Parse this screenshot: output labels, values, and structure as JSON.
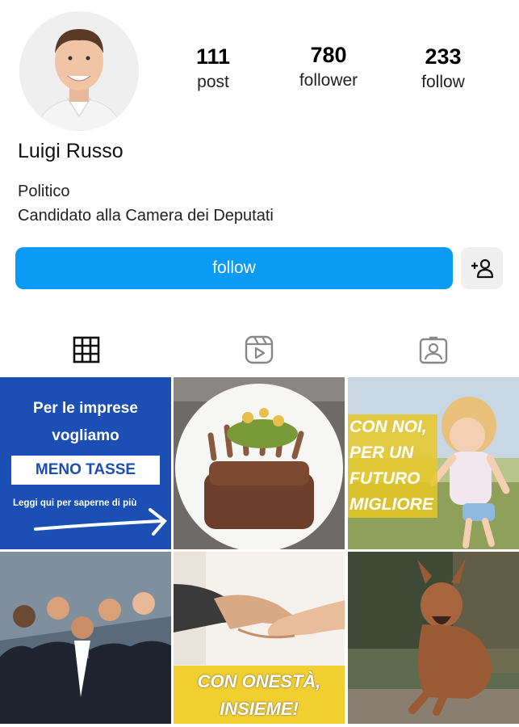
{
  "profile": {
    "name": "Luigi Russo",
    "bio_line1": "Politico",
    "bio_line2": "Candidato alla Camera dei Deputati"
  },
  "stats": [
    {
      "value": "111",
      "label": "post"
    },
    {
      "value": "780",
      "label": "follower"
    },
    {
      "value": "233",
      "label": "follow"
    }
  ],
  "actions": {
    "follow_label": "follow",
    "add_icon": "person-plus-icon"
  },
  "tabs": [
    {
      "icon": "grid-icon",
      "active": true
    },
    {
      "icon": "reels-icon",
      "active": false
    },
    {
      "icon": "tagged-icon",
      "active": false
    }
  ],
  "posts": [
    {
      "lines": [
        "Per le imprese",
        "vogliamo"
      ],
      "box": "MENO TASSE",
      "footer": "Leggi qui per saperne di più",
      "bg": "#1b4fb3"
    },
    {
      "icon": "food-photo"
    },
    {
      "lines": [
        "CON NOI,",
        "PER UN",
        "FUTURO",
        "MIGLIORE"
      ]
    },
    {
      "icon": "team-photo"
    },
    {
      "lines": [
        "CON ONESTÀ,",
        "INSIEME!"
      ]
    },
    {
      "icon": "dog-photo"
    }
  ],
  "colors": {
    "accent": "#0b9bf5",
    "post1_bg": "#1b4fb3",
    "yellow": "#f2cf30"
  }
}
